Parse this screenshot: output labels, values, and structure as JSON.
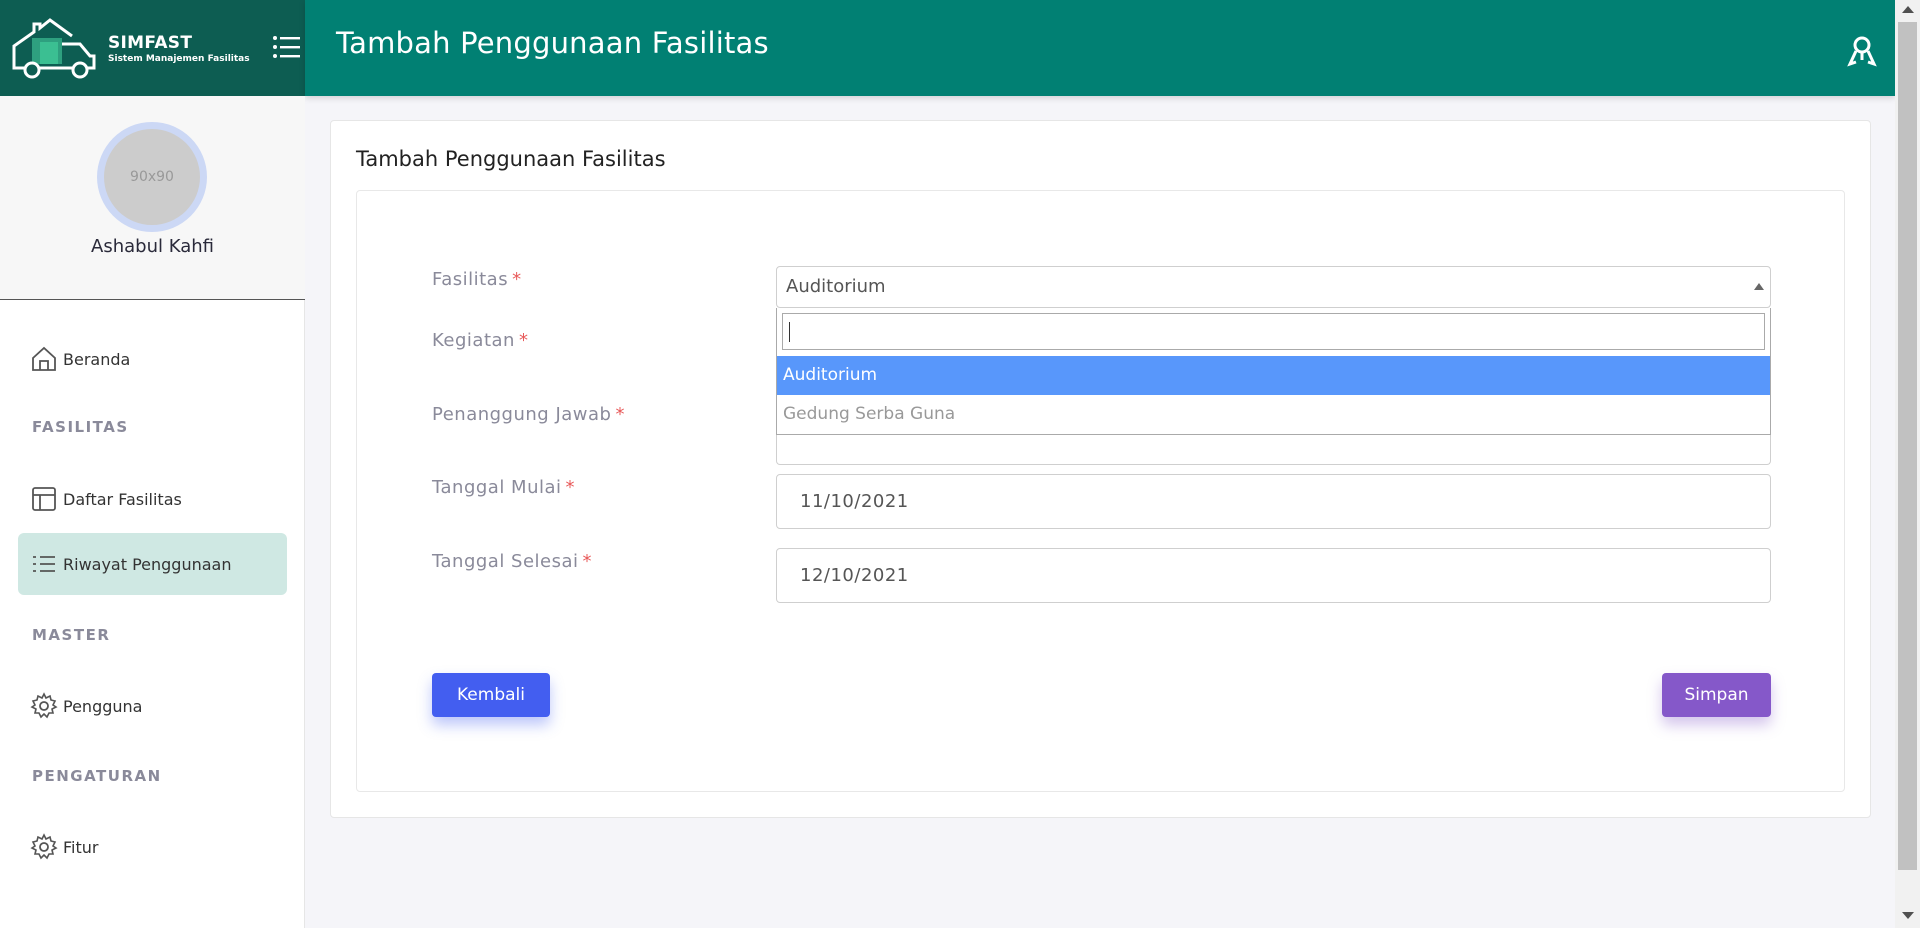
{
  "brand": {
    "name": "SIMFAST",
    "subtitle": "Sistem Manajemen Fasilitas",
    "logo_icon": "truck-house-logo",
    "menu_icon": "menu-list-icon"
  },
  "header": {
    "title": "Tambah Penggunaan Fasilitas",
    "user_icon": "user-icon"
  },
  "profile": {
    "avatar_placeholder": "90x90",
    "name": "Ashabul Kahfi"
  },
  "sidebar": {
    "home": {
      "label": "Beranda",
      "icon": "home-icon"
    },
    "section_fasilitas": "FASILITAS",
    "daftar": {
      "label": "Daftar Fasilitas",
      "icon": "layout-icon"
    },
    "riwayat": {
      "label": "Riwayat Penggunaan",
      "icon": "list-icon"
    },
    "section_master": "MASTER",
    "pengguna": {
      "label": "Pengguna",
      "icon": "gear-icon"
    },
    "section_pengaturan": "PENGATURAN",
    "fitur": {
      "label": "Fitur",
      "icon": "gear-icon"
    }
  },
  "form": {
    "card_title": "Tambah Penggunaan Fasilitas",
    "fasilitas": {
      "label": "Fasilitas",
      "value": "Auditorium"
    },
    "kegiatan": {
      "label": "Kegiatan"
    },
    "penanggung_jawab": {
      "label": "Penanggung Jawab"
    },
    "tanggal_mulai": {
      "label": "Tanggal Mulai",
      "value": "11/10/2021"
    },
    "tanggal_selesai": {
      "label": "Tanggal Selesai",
      "value": "12/10/2021"
    },
    "required_mark": "*",
    "dropdown": {
      "search_value": "",
      "options": [
        "Auditorium",
        "Gedung Serba Guna"
      ]
    },
    "back_label": "Kembali",
    "save_label": "Simpan"
  },
  "colors": {
    "brand_dark": "#0d5d52",
    "header": "#018073",
    "active_nav": "#cfe8e3",
    "primary_button": "#435ef0",
    "save_button": "#8558c9",
    "dropdown_highlight": "#5897fb"
  }
}
